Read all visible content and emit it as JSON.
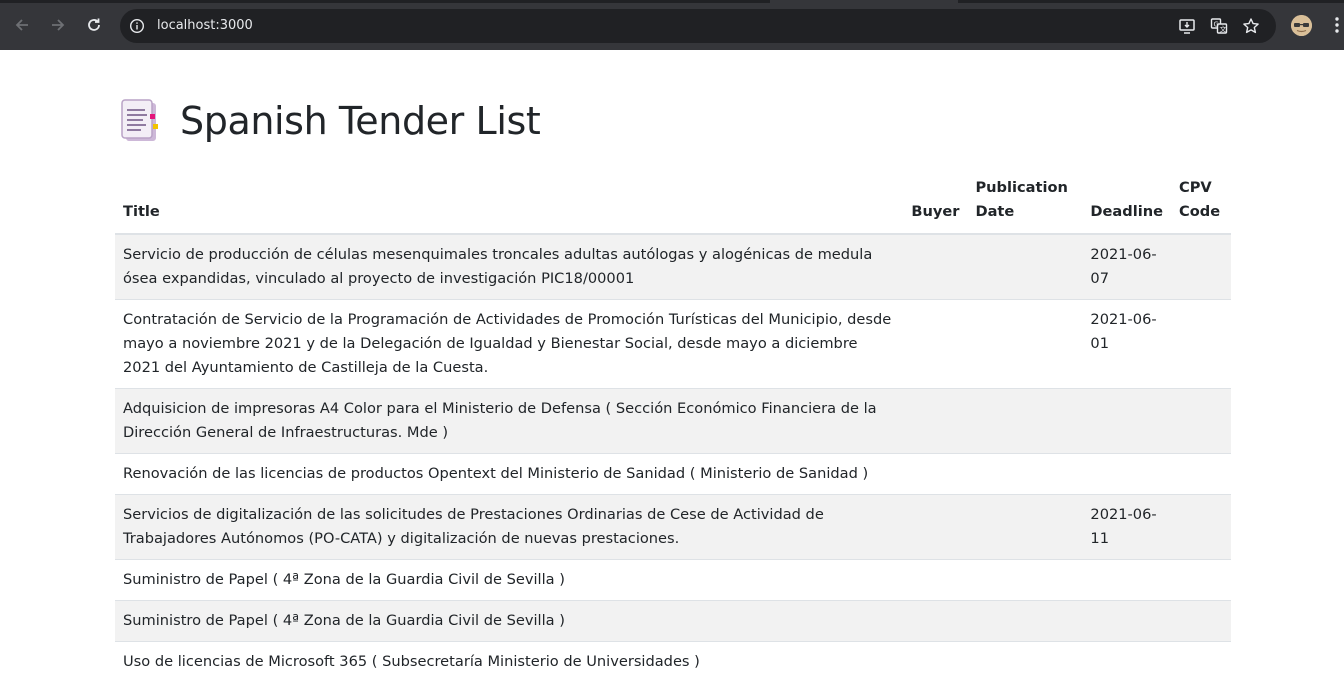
{
  "browser": {
    "url": "localhost:3000",
    "back_icon": "arrow-left-icon",
    "forward_icon": "arrow-right-icon",
    "reload_icon": "reload-icon",
    "info_icon": "info-icon",
    "install_icon": "install-app-icon",
    "translate_icon": "translate-icon",
    "bookmark_icon": "star-icon",
    "menu_icon": "kebab-menu-icon"
  },
  "page": {
    "title": "Spanish Tender List",
    "title_icon": "document-icon"
  },
  "table": {
    "headers": {
      "title": "Title",
      "buyer": "Buyer",
      "publication_date": "Publication Date",
      "deadline": "Deadline",
      "cpv_code": "CPV Code"
    },
    "rows": [
      {
        "title": "Servicio de producción de células mesenquimales troncales adultas autólogas y alogénicas de medula ósea expandidas, vinculado al proyecto de investigación PIC18/00001",
        "buyer": "",
        "publication_date": "",
        "deadline": "2021-06-07",
        "cpv_code": ""
      },
      {
        "title": "Contratación de Servicio de la Programación de Actividades de Promoción Turísticas del Municipio, desde mayo a noviembre 2021 y de la Delegación de Igualdad y Bienestar Social, desde mayo a diciembre 2021 del Ayuntamiento de Castilleja de la Cuesta.",
        "buyer": "",
        "publication_date": "",
        "deadline": "2021-06-01",
        "cpv_code": ""
      },
      {
        "title": "Adquisicion de impresoras A4 Color para el Ministerio de Defensa ( Sección Económico Financiera de la Dirección General de Infraestructuras. Mde )",
        "buyer": "",
        "publication_date": "",
        "deadline": "",
        "cpv_code": ""
      },
      {
        "title": "Renovación de las licencias de productos Opentext del Ministerio de Sanidad ( Ministerio de Sanidad )",
        "buyer": "",
        "publication_date": "",
        "deadline": "",
        "cpv_code": ""
      },
      {
        "title": "Servicios de digitalización de las solicitudes de Prestaciones Ordinarias de Cese de Actividad de Trabajadores Autónomos (PO-CATA) y digitalización de nuevas prestaciones.",
        "buyer": "",
        "publication_date": "",
        "deadline": "2021-06-11",
        "cpv_code": ""
      },
      {
        "title": "Suministro de Papel ( 4ª Zona de la Guardia Civil de Sevilla )",
        "buyer": "",
        "publication_date": "",
        "deadline": "",
        "cpv_code": ""
      },
      {
        "title": "Suministro de Papel ( 4ª Zona de la Guardia Civil de Sevilla )",
        "buyer": "",
        "publication_date": "",
        "deadline": "",
        "cpv_code": ""
      },
      {
        "title": "Uso de licencias de Microsoft 365 ( Subsecretaría Ministerio de Universidades )",
        "buyer": "",
        "publication_date": "",
        "deadline": "",
        "cpv_code": ""
      }
    ]
  }
}
